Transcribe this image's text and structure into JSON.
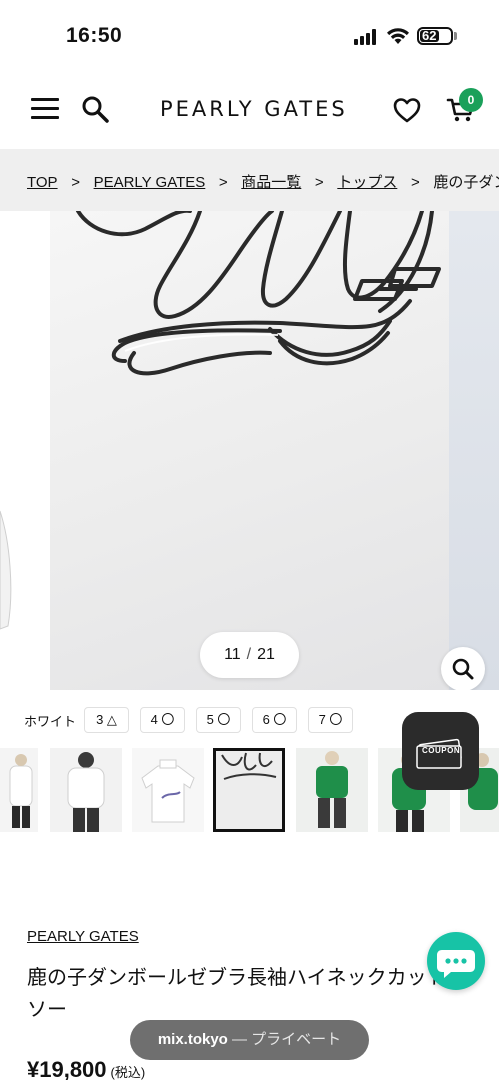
{
  "status_bar": {
    "time": "16:50",
    "battery": "62"
  },
  "header": {
    "logo": "PEARLY GATES",
    "cart_count": "0"
  },
  "breadcrumb": [
    {
      "label": "TOP"
    },
    {
      "label": "PEARLY GATES"
    },
    {
      "label": "商品一覧"
    },
    {
      "label": "トップス"
    },
    {
      "label": "鹿の子ダンボールゼブラ長袖ハイネックカットソー"
    }
  ],
  "gallery": {
    "current": "11",
    "total": "21"
  },
  "variants": {
    "color": "ホワイト",
    "sizes": [
      {
        "size": "3",
        "stock": "△"
      },
      {
        "size": "4",
        "stock": "〇"
      },
      {
        "size": "5",
        "stock": "〇"
      },
      {
        "size": "6",
        "stock": "〇"
      },
      {
        "size": "7",
        "stock": "〇"
      }
    ]
  },
  "coupon": {
    "label": "COUPON"
  },
  "product": {
    "brand": "PEARLY GATES",
    "title": "鹿の子ダンボールゼブラ長袖ハイネックカットソー",
    "price": "¥19,800",
    "tax_note": "(税込)"
  },
  "browser": {
    "host": "mix.tokyo",
    "mode": " — プライベート"
  },
  "colors": {
    "cart_badge": "#1aa05a",
    "chat": "#17c3a6",
    "breadcrumb_bg": "#efefef"
  }
}
